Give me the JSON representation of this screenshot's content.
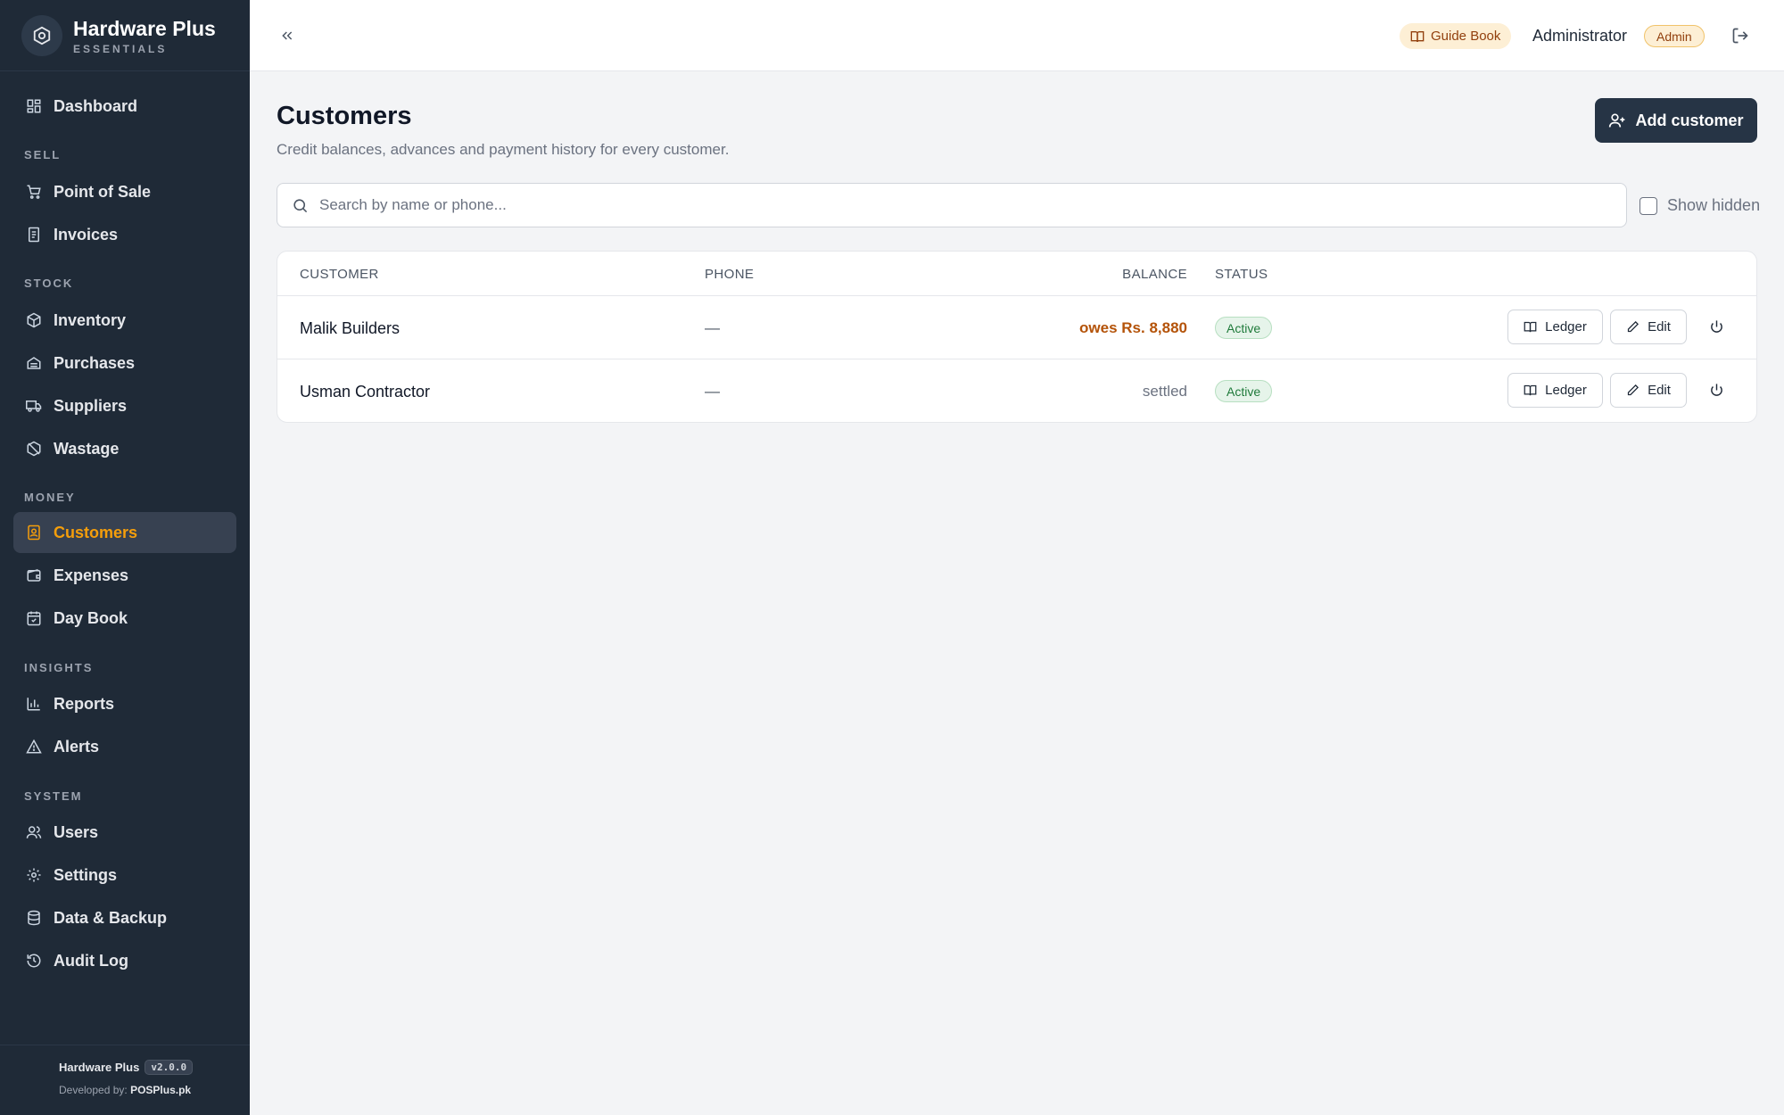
{
  "brand": {
    "title": "Hardware Plus",
    "subtitle": "ESSENTIALS"
  },
  "nav": {
    "dashboard": "Dashboard",
    "sections": {
      "sell": "SELL",
      "stock": "STOCK",
      "money": "MONEY",
      "insights": "INSIGHTS",
      "system": "SYSTEM"
    },
    "items": {
      "pos": "Point of Sale",
      "invoices": "Invoices",
      "inventory": "Inventory",
      "purchases": "Purchases",
      "suppliers": "Suppliers",
      "wastage": "Wastage",
      "customers": "Customers",
      "expenses": "Expenses",
      "daybook": "Day Book",
      "reports": "Reports",
      "alerts": "Alerts",
      "users": "Users",
      "settings": "Settings",
      "backup": "Data & Backup",
      "audit": "Audit Log"
    },
    "active": "customers"
  },
  "footer": {
    "app_name": "Hardware Plus",
    "version": "v2.0.0",
    "developed_label": "Developed by:",
    "developer": "POSPlus.pk"
  },
  "header": {
    "guide_label": "Guide Book",
    "user_name": "Administrator",
    "role": "Admin"
  },
  "page": {
    "title": "Customers",
    "subtitle": "Credit balances, advances and payment history for every customer.",
    "add_button": "Add customer"
  },
  "search": {
    "placeholder": "Search by name or phone...",
    "value": ""
  },
  "show_hidden_label": "Show hidden",
  "table": {
    "headers": {
      "customer": "CUSTOMER",
      "phone": "PHONE",
      "balance": "BALANCE",
      "status": "STATUS"
    },
    "rows": [
      {
        "name": "Malik Builders",
        "phone": "—",
        "balance": "owes Rs. 8,880",
        "status": "Active",
        "ledger": "Ledger",
        "edit": "Edit"
      },
      {
        "name": "Usman Contractor",
        "phone": "—",
        "balance": "settled",
        "status": "Active",
        "ledger": "Ledger",
        "edit": "Edit"
      }
    ]
  },
  "colors": {
    "sidebar_bg": "#1f2a37",
    "accent": "#f59e0b",
    "primary_button": "#263445",
    "owes": "#b45309",
    "active_badge": "#1f7a3a"
  }
}
